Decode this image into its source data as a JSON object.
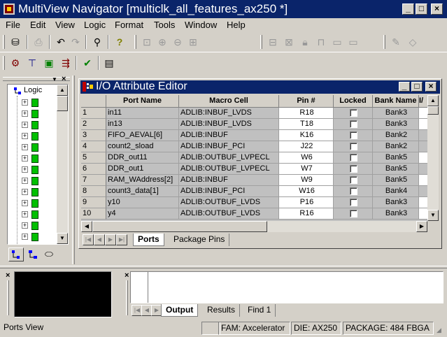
{
  "app": {
    "title": "MultiView Navigator [multiclk_all_features_ax250 *]",
    "window_buttons": {
      "minimize": "_",
      "maximize": "□",
      "close": "×"
    }
  },
  "menu": [
    "File",
    "Edit",
    "View",
    "Logic",
    "Format",
    "Tools",
    "Window",
    "Help"
  ],
  "left_panel": {
    "root_label": "Logic"
  },
  "editor": {
    "title": "I/O Attribute Editor",
    "columns": [
      "Port Name",
      "Macro Cell",
      "Pin #",
      "Locked",
      "Bank Name",
      "I/"
    ],
    "rows": [
      {
        "num": "1",
        "port": "in11",
        "macro": "ADLIB:INBUF_LVDS",
        "pin": "R18",
        "bank": "Bank3"
      },
      {
        "num": "2",
        "port": "in13",
        "macro": "ADLIB:INBUF_LVDS",
        "pin": "T18",
        "bank": "Bank3"
      },
      {
        "num": "3",
        "port": "FIFO_AEVAL[6]",
        "macro": "ADLIB:INBUF",
        "pin": "K16",
        "bank": "Bank2"
      },
      {
        "num": "4",
        "port": "count2_sload",
        "macro": "ADLIB:INBUF_PCI",
        "pin": "J22",
        "bank": "Bank2"
      },
      {
        "num": "5",
        "port": "DDR_out11",
        "macro": "ADLIB:OUTBUF_LVPECL",
        "pin": "W6",
        "bank": "Bank5"
      },
      {
        "num": "6",
        "port": "DDR_out1",
        "macro": "ADLIB:OUTBUF_LVPECL",
        "pin": "W7",
        "bank": "Bank5"
      },
      {
        "num": "7",
        "port": "RAM_WAddress[2]",
        "macro": "ADLIB:INBUF",
        "pin": "W9",
        "bank": "Bank5"
      },
      {
        "num": "8",
        "port": "count3_data[1]",
        "macro": "ADLIB:INBUF_PCI",
        "pin": "W16",
        "bank": "Bank4"
      },
      {
        "num": "9",
        "port": "y10",
        "macro": "ADLIB:OUTBUF_LVDS",
        "pin": "P16",
        "bank": "Bank3"
      },
      {
        "num": "10",
        "port": "y4",
        "macro": "ADLIB:OUTBUF_LVDS",
        "pin": "R16",
        "bank": "Bank3"
      }
    ],
    "tabs": [
      "Ports",
      "Package Pins"
    ]
  },
  "log_tabs": [
    "Output",
    "Results",
    "Find 1"
  ],
  "status": {
    "left": "Ports View",
    "family": "FAM: Axcelerator",
    "die": "DIE: AX250",
    "package": "PACKAGE: 484 FBGA"
  }
}
